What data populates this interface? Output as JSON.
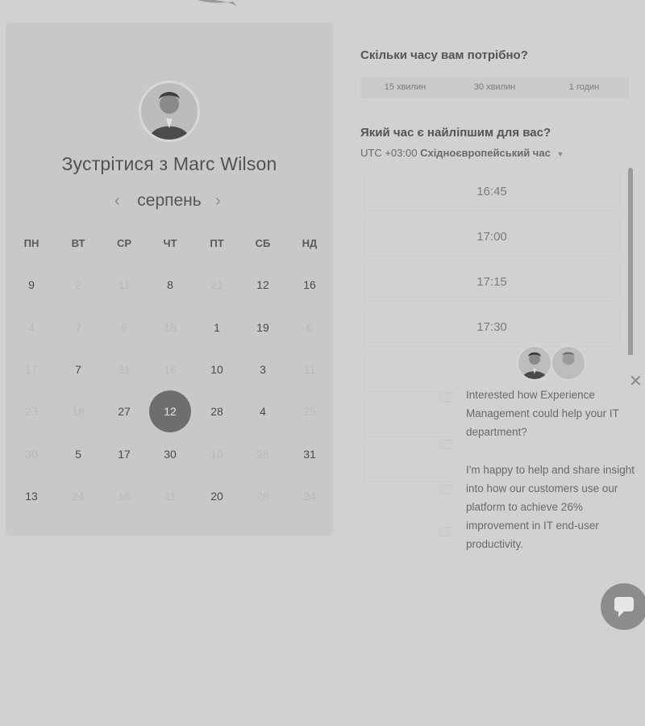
{
  "calendar": {
    "title_prefix": "Зустрітися з",
    "title_name": "Marc Wilson",
    "month": "серпень",
    "prev_arrow": "‹",
    "next_arrow": "›",
    "weekdays": [
      "ПН",
      "ВТ",
      "СР",
      "ЧТ",
      "ПТ",
      "СБ",
      "НД"
    ],
    "weeks": [
      [
        {
          "d": "9",
          "dim": false
        },
        {
          "d": "2",
          "dim": true
        },
        {
          "d": "11",
          "dim": true
        },
        {
          "d": "8",
          "dim": false
        },
        {
          "d": "21",
          "dim": true
        },
        {
          "d": "12",
          "dim": false
        },
        {
          "d": "16",
          "dim": false
        }
      ],
      [
        {
          "d": "4",
          "dim": true
        },
        {
          "d": "7",
          "dim": true
        },
        {
          "d": "6",
          "dim": true
        },
        {
          "d": "18",
          "dim": true
        },
        {
          "d": "1",
          "dim": false
        },
        {
          "d": "19",
          "dim": false
        },
        {
          "d": "6",
          "dim": true
        }
      ],
      [
        {
          "d": "17",
          "dim": true
        },
        {
          "d": "7",
          "dim": false
        },
        {
          "d": "31",
          "dim": true
        },
        {
          "d": "16",
          "dim": true
        },
        {
          "d": "10",
          "dim": false
        },
        {
          "d": "3",
          "dim": false
        },
        {
          "d": "11",
          "dim": true
        }
      ],
      [
        {
          "d": "23",
          "dim": true
        },
        {
          "d": "18",
          "dim": true
        },
        {
          "d": "27",
          "dim": false
        },
        {
          "d": "12",
          "dim": false,
          "selected": true
        },
        {
          "d": "28",
          "dim": false
        },
        {
          "d": "4",
          "dim": false
        },
        {
          "d": "25",
          "dim": true
        }
      ],
      [
        {
          "d": "30",
          "dim": true
        },
        {
          "d": "5",
          "dim": false
        },
        {
          "d": "17",
          "dim": false
        },
        {
          "d": "30",
          "dim": false
        },
        {
          "d": "10",
          "dim": true
        },
        {
          "d": "28",
          "dim": true
        },
        {
          "d": "31",
          "dim": false
        }
      ],
      [
        {
          "d": "13",
          "dim": false
        },
        {
          "d": "24",
          "dim": true
        },
        {
          "d": "16",
          "dim": true
        },
        {
          "d": "11",
          "dim": true
        },
        {
          "d": "20",
          "dim": false
        },
        {
          "d": "28",
          "dim": true
        },
        {
          "d": "24",
          "dim": true
        }
      ]
    ]
  },
  "duration": {
    "question": "Скільки часу вам потрібно?",
    "options": [
      "15 хвилин",
      "30 хвилин",
      "1 годин"
    ]
  },
  "time": {
    "question": "Який час є найліпшим для вас?",
    "timezone_offset": "UTC +03:00",
    "timezone_name": "Східноєвропейський час",
    "slots": [
      "16:45",
      "17:00",
      "17:15",
      "17:30"
    ]
  },
  "chat": {
    "message1": "Interested how Experience Management could help your IT department?",
    "message2": "I'm happy to help and share insight into how our customers use our platform to achieve 26% improvement in IT end-user productivity.",
    "close_icon": "close-icon"
  }
}
